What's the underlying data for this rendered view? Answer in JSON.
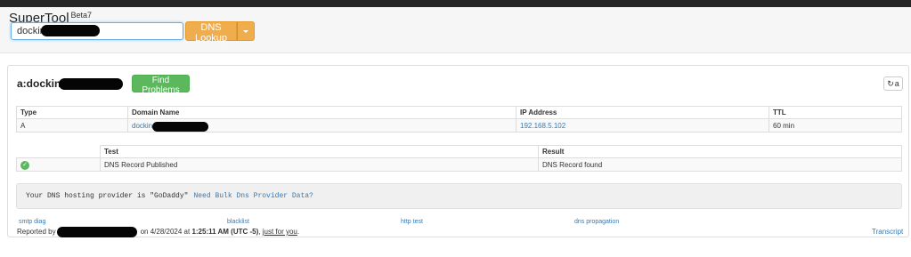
{
  "app": {
    "brand": "SuperTool",
    "version": "Beta7"
  },
  "search": {
    "value": "docking.",
    "action_label": "DNS Lookup"
  },
  "result": {
    "title": "a:docking.",
    "find_problems_label": "Find Problems",
    "refresh_label": "a"
  },
  "records": {
    "headers": [
      "Type",
      "Domain Name",
      "IP Address",
      "TTL"
    ],
    "rows": [
      {
        "type": "A",
        "domain": "docking.",
        "ip": "192.168.5.102",
        "ttl": "60 min"
      }
    ]
  },
  "tests": {
    "headers": [
      "Test",
      "Result"
    ],
    "rows": [
      {
        "status_icon": "check-circle-icon",
        "test": "DNS Record Published",
        "result": "DNS Record found"
      }
    ]
  },
  "provider_note": {
    "text": "Your DNS hosting provider is \"GoDaddy\"",
    "link": "Need Bulk Dns Provider Data?"
  },
  "links": {
    "smtp": "smtp diag",
    "blacklist": "blacklist",
    "http": "http test",
    "dns": "dns propagation"
  },
  "footer": {
    "reported_by": "Reported by",
    "date_prefix": "on 4/28/2024 at",
    "time": "1:25:11 AM (UTC -5)",
    "sep": ",",
    "just_for_you": "just for you",
    "end": ".",
    "transcript": "Transcript"
  },
  "colors": {
    "accent_orange": "#f0ad4e",
    "success_green": "#5cb85c",
    "link_blue": "#337ab7"
  }
}
